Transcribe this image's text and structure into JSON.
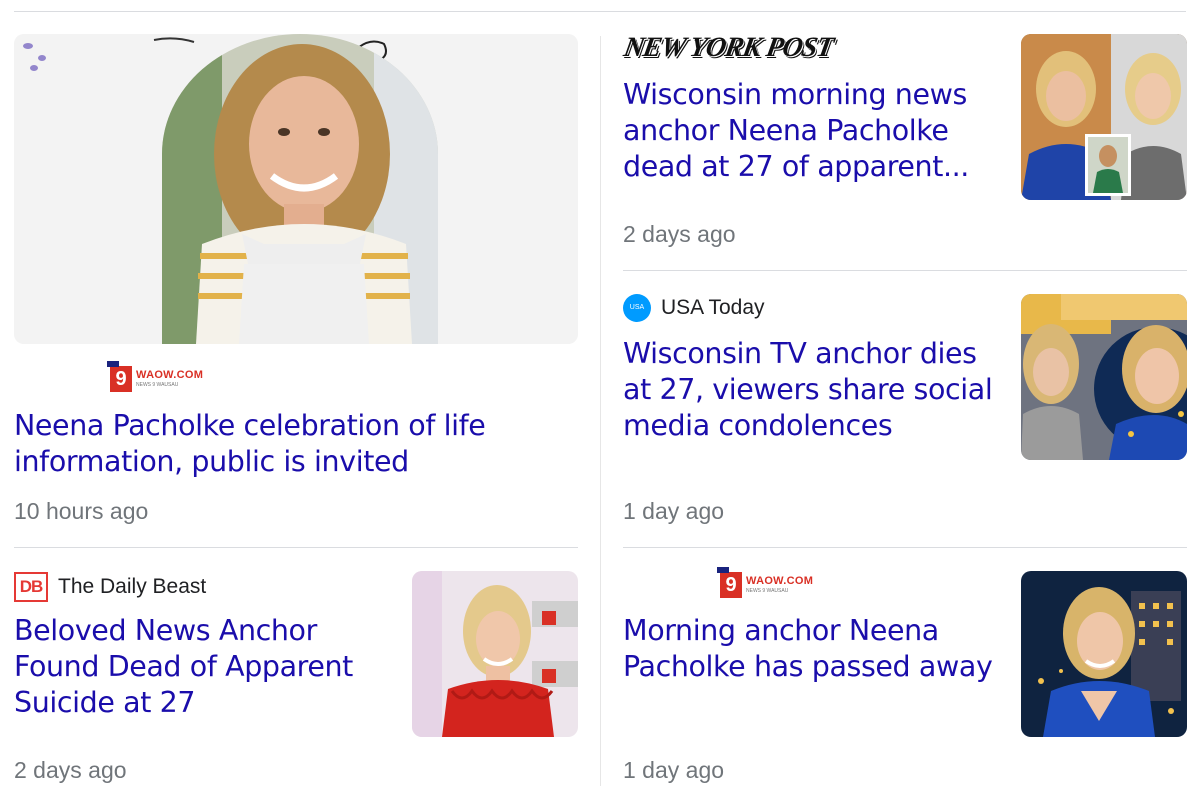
{
  "articles": [
    {
      "source": "WAOW.COM",
      "source_logo": "waow-9-logo",
      "title": "Neena Pacholke celebration of life information, public is invited",
      "time": "10 hours ago",
      "image": "woman-striped-shirt-arch-photo"
    },
    {
      "source": "NEW YORK POST",
      "source_logo": "new-york-post-logo",
      "title": "Wisconsin morning news anchor Neena Pacholke dead at 27 of apparent...",
      "time": "2 days ago",
      "image": "news-anchor-collage-thumbnail"
    },
    {
      "source": "USA Today",
      "source_logo": "usa-today-logo",
      "title": "Wisconsin TV anchor dies at 27, viewers share social media condolences",
      "time": "1 day ago",
      "image": "anchor-studio-thumbnail"
    },
    {
      "source": "The Daily Beast",
      "source_logo": "daily-beast-logo",
      "title": "Beloved News Anchor Found Dead of Apparent Suicide at 27",
      "time": "2 days ago",
      "image": "anchor-red-dress-thumbnail"
    },
    {
      "source": "WAOW.COM",
      "source_logo": "waow-9-logo",
      "title": "Morning anchor Neena Pacholke has passed away",
      "time": "1 day ago",
      "image": "anchor-night-city-thumbnail"
    }
  ],
  "logo_text": {
    "waow_nine": "9",
    "waow_name": "WAOW.COM",
    "waow_tagline": "NEWS 9 WAUSAU",
    "nyp": "NEW YORK POST",
    "usat": "USA TODAY",
    "db": "DB"
  },
  "colors": {
    "title_link": "#1a0dab",
    "time": "#70757a",
    "divider": "#dadce0"
  }
}
